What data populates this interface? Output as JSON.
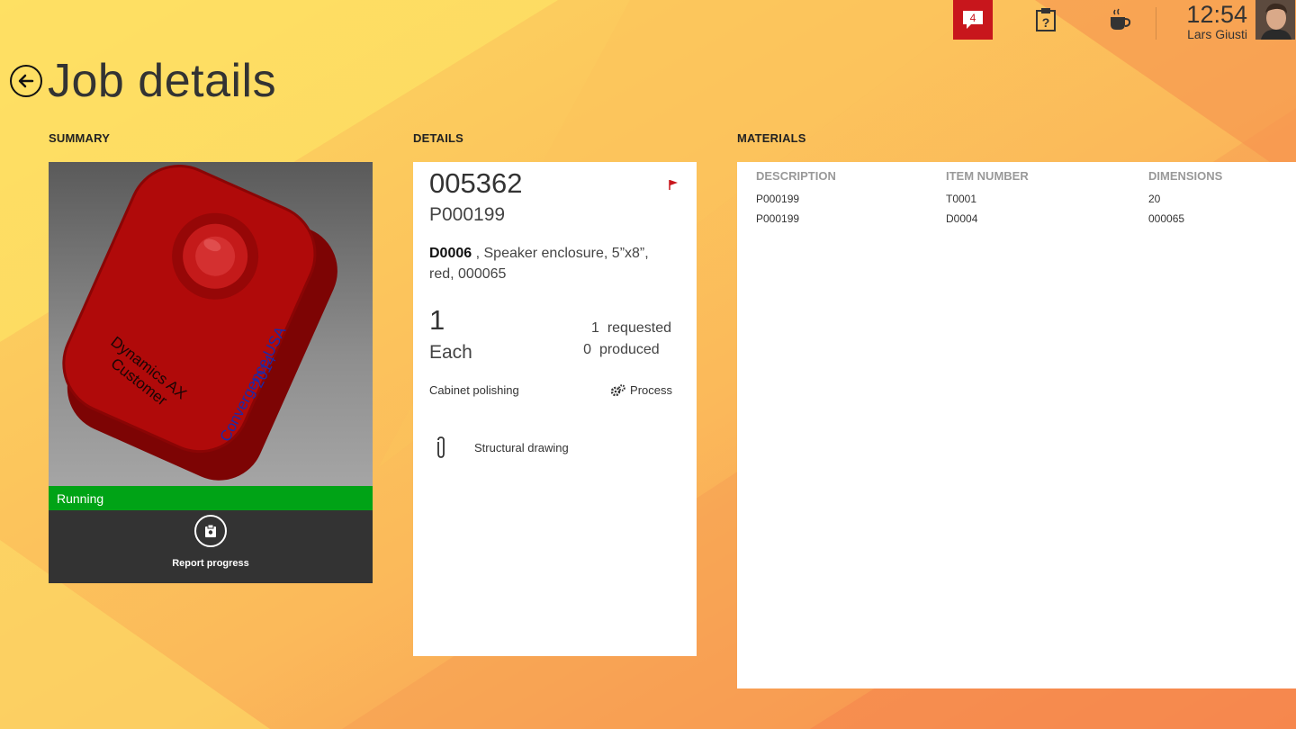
{
  "topbar": {
    "notification_count": "4",
    "time": "12:54",
    "user_name": "Lars Giusti",
    "icons": [
      "chat-bubble-icon",
      "clipboard-question-icon",
      "coffee-cup-icon"
    ]
  },
  "page": {
    "title": "Job details"
  },
  "sections": {
    "summary": "SUMMARY",
    "details": "DETAILS",
    "materials": "MATERIALS"
  },
  "summary": {
    "status": "Running",
    "status_color": "#00a316",
    "report_label": "Report progress"
  },
  "details": {
    "job_id": "005362",
    "production_order": "P000199",
    "item_code": "D0006",
    "item_desc": " , Speaker enclosure, 5”x8”, red, 000065",
    "quantity": "1",
    "unit": "Each",
    "requested_count": "1",
    "requested_label": "requested",
    "produced_count": "0",
    "produced_label": "produced",
    "operation": "Cabinet polishing",
    "process_label": "Process",
    "attachment": "Structural drawing"
  },
  "materials": {
    "columns": [
      "DESCRIPTION",
      "ITEM NUMBER",
      "DIMENSIONS"
    ],
    "rows": [
      [
        "P000199",
        "T0001",
        "20"
      ],
      [
        "P000199",
        "D0004",
        "000065"
      ]
    ]
  },
  "colors": {
    "accent_red": "#c8161c",
    "running_green": "#00a316"
  }
}
